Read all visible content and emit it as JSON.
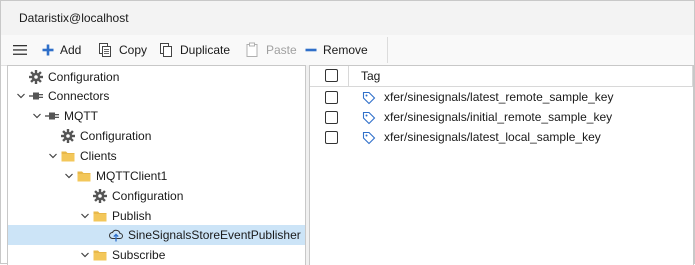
{
  "window": {
    "title": "Dataristix@localhost"
  },
  "toolbar": {
    "add_label": "Add",
    "copy_label": "Copy",
    "duplicate_label": "Duplicate",
    "paste_label": "Paste",
    "remove_label": "Remove"
  },
  "tree": {
    "items": [
      {
        "label": "Configuration",
        "icon": "gear-icon"
      },
      {
        "label": "Connectors",
        "icon": "plug-icon"
      },
      {
        "label": "MQTT",
        "icon": "plug-icon"
      },
      {
        "label": "Configuration",
        "icon": "gear-icon"
      },
      {
        "label": "Clients",
        "icon": "folder-icon"
      },
      {
        "label": "MQTTClient1",
        "icon": "folder-icon"
      },
      {
        "label": "Configuration",
        "icon": "gear-icon"
      },
      {
        "label": "Publish",
        "icon": "folder-icon"
      },
      {
        "label": "SineSignalsStoreEventPublisher",
        "icon": "cloud-upload-icon"
      },
      {
        "label": "Subscribe",
        "icon": "folder-icon"
      }
    ],
    "selected_index": 8
  },
  "grid": {
    "column_header": "Tag",
    "rows": [
      {
        "tag": "xfer/sinesignals/latest_remote_sample_key"
      },
      {
        "tag": "xfer/sinesignals/initial_remote_sample_key"
      },
      {
        "tag": "xfer/sinesignals/latest_local_sample_key"
      }
    ]
  },
  "colors": {
    "accent_blue": "#2f6fc9",
    "folder_yellow": "#e8b84a",
    "selection": "#cce4f7"
  }
}
